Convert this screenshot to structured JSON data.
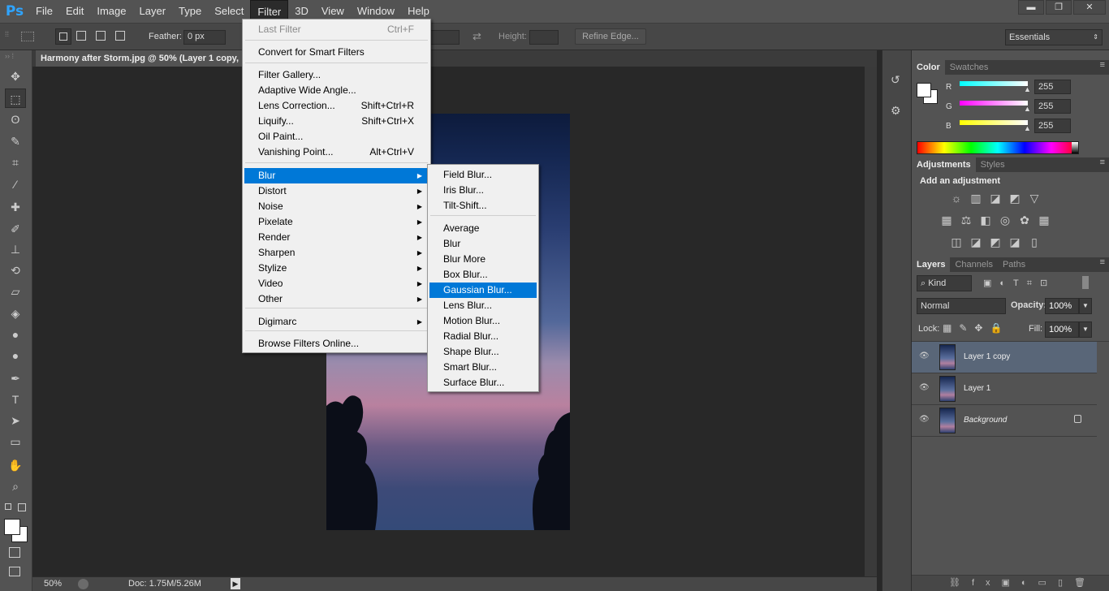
{
  "app": {
    "logo": "Ps"
  },
  "menubar": {
    "items": [
      "File",
      "Edit",
      "Image",
      "Layer",
      "Type",
      "Select",
      "Filter",
      "3D",
      "View",
      "Window",
      "Help"
    ],
    "active": "Filter"
  },
  "window_controls": {
    "minimize": "▬",
    "restore": "❐",
    "close": "✕"
  },
  "options": {
    "feather_label": "Feather:",
    "feather_value": "0 px",
    "height_label": "Height:",
    "refine_edge": "Refine Edge...",
    "workspace": "Essentials"
  },
  "document": {
    "tab_title": "Harmony after Storm.jpg @ 50% (Layer 1 copy,",
    "zoom": "50%",
    "doc_info": "Doc: 1.75M/5.26M"
  },
  "filter_menu": {
    "items": [
      {
        "label": "Last Filter",
        "shortcut": "Ctrl+F",
        "disabled": true
      },
      {
        "label": "Convert for Smart Filters"
      },
      {
        "label": "Filter Gallery..."
      },
      {
        "label": "Adaptive Wide Angle..."
      },
      {
        "label": "Lens Correction...",
        "shortcut": "Shift+Ctrl+R"
      },
      {
        "label": "Liquify...",
        "shortcut": "Shift+Ctrl+X"
      },
      {
        "label": "Oil Paint..."
      },
      {
        "label": "Vanishing Point...",
        "shortcut": "Alt+Ctrl+V"
      },
      {
        "label": "Blur",
        "submenu": true,
        "highlighted": true
      },
      {
        "label": "Distort",
        "submenu": true
      },
      {
        "label": "Noise",
        "submenu": true
      },
      {
        "label": "Pixelate",
        "submenu": true
      },
      {
        "label": "Render",
        "submenu": true
      },
      {
        "label": "Sharpen",
        "submenu": true
      },
      {
        "label": "Stylize",
        "submenu": true
      },
      {
        "label": "Video",
        "submenu": true
      },
      {
        "label": "Other",
        "submenu": true
      },
      {
        "label": "Digimarc",
        "submenu": true
      },
      {
        "label": "Browse Filters Online..."
      }
    ]
  },
  "blur_submenu": {
    "items": [
      {
        "label": "Field Blur..."
      },
      {
        "label": "Iris Blur..."
      },
      {
        "label": "Tilt-Shift..."
      },
      {
        "label": "Average"
      },
      {
        "label": "Blur"
      },
      {
        "label": "Blur More"
      },
      {
        "label": "Box Blur..."
      },
      {
        "label": "Gaussian Blur...",
        "highlighted": true
      },
      {
        "label": "Lens Blur..."
      },
      {
        "label": "Motion Blur..."
      },
      {
        "label": "Radial Blur..."
      },
      {
        "label": "Shape Blur..."
      },
      {
        "label": "Smart Blur..."
      },
      {
        "label": "Surface Blur..."
      }
    ]
  },
  "color_panel": {
    "tabs": [
      "Color",
      "Swatches"
    ],
    "channels": [
      {
        "label": "R",
        "value": "255",
        "color": "#00ffff"
      },
      {
        "label": "G",
        "value": "255",
        "color": "#ff00ff"
      },
      {
        "label": "B",
        "value": "255",
        "color": "#ffff00"
      }
    ]
  },
  "adjustments_panel": {
    "tabs": [
      "Adjustments",
      "Styles"
    ],
    "heading": "Add an adjustment"
  },
  "layers_panel": {
    "tabs": [
      "Layers",
      "Channels",
      "Paths"
    ],
    "filter_kind": "Kind",
    "blend_mode": "Normal",
    "opacity_label": "Opacity:",
    "opacity_value": "100%",
    "lock_label": "Lock:",
    "fill_label": "Fill:",
    "fill_value": "100%",
    "layers": [
      {
        "name": "Layer 1 copy",
        "selected": true
      },
      {
        "name": "Layer 1"
      },
      {
        "name": "Background",
        "locked": true
      }
    ]
  },
  "colors": {
    "menu_highlight": "#0078d7",
    "ps_blue": "#2fa4ff"
  }
}
